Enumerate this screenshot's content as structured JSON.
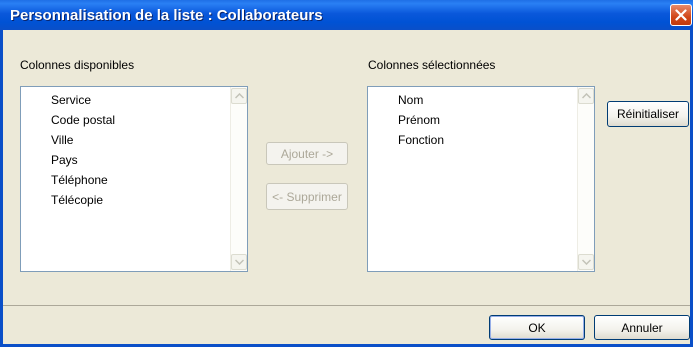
{
  "window": {
    "title": "Personnalisation de la liste : Collaborateurs"
  },
  "available": {
    "label": "Colonnes disponibles",
    "items": [
      "Service",
      "Code postal",
      "Ville",
      "Pays",
      "Téléphone",
      "Télécopie"
    ]
  },
  "selected": {
    "label": "Colonnes sélectionnées",
    "items": [
      "Nom",
      "Prénom",
      "Fonction"
    ]
  },
  "buttons": {
    "add": "Ajouter ->",
    "remove": "<- Supprimer",
    "reset": "Réinitialiser",
    "ok": "OK",
    "cancel": "Annuler"
  },
  "icons": {
    "close": "close-icon",
    "scroll_up": "scroll-up-arrow-icon",
    "scroll_down": "scroll-down-arrow-icon"
  },
  "colors": {
    "title_bar": "#0a58db",
    "close_button": "#d14718",
    "dialog_bg": "#ece9d8",
    "list_border": "#7f9db9"
  }
}
